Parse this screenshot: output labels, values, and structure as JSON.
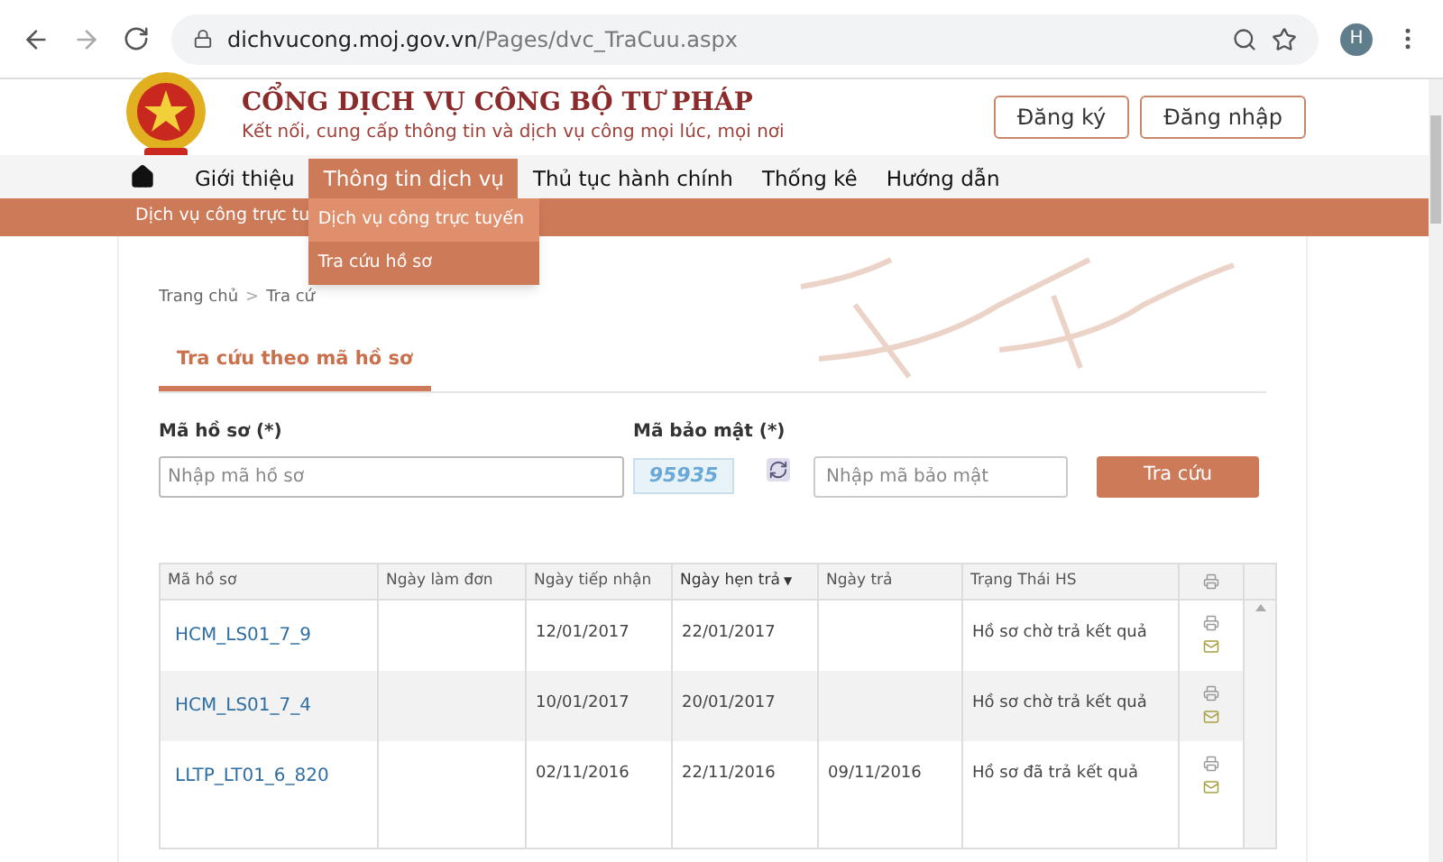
{
  "browser": {
    "url_host": "dichvucong.moj.gov.vn",
    "url_path": "/Pages/dvc_TraCuu.aspx",
    "profile": "H"
  },
  "header": {
    "title": "CỔNG DỊCH VỤ CÔNG BỘ TƯ PHÁP",
    "subtitle": "Kết nối, cung cấp thông tin và dịch vụ công mọi lúc, mọi nơi",
    "buttons": [
      "Đăng ký",
      "Đăng nhập"
    ]
  },
  "nav": {
    "items": [
      {
        "label": "Giới thiệu",
        "selected": false
      },
      {
        "label": "Thông tin dịch vụ",
        "selected": true
      },
      {
        "label": "Thủ tục hành chính",
        "selected": false
      },
      {
        "label": "Thống kê",
        "selected": false
      },
      {
        "label": "Hướng dẫn",
        "selected": false
      }
    ],
    "sub_bar": "Dịch vụ công trực tu",
    "dropdown": [
      {
        "label": "Dịch vụ công trực tuyến",
        "selected": true
      },
      {
        "label": "Tra cứu hồ sơ",
        "selected": false
      }
    ]
  },
  "breadcrumb": {
    "home": "Trang chủ",
    "separator": ">",
    "current": "Tra cứ"
  },
  "tabs": [
    {
      "label": "Tra cứu theo mã hồ sơ",
      "selected": true
    }
  ],
  "form": {
    "code_label": "Mã hồ sơ (*)",
    "code_placeholder": "Nhập mã hồ sơ",
    "captcha_label": "Mã bảo mật (*)",
    "captcha": "95935",
    "captcha_placeholder": "Nhập mã bảo mật",
    "submit": "Tra cứu"
  },
  "table": {
    "columns": [
      {
        "label": "Mã hồ sơ",
        "sorted": false
      },
      {
        "label": "Ngày làm đơn",
        "sorted": false
      },
      {
        "label": "Ngày tiếp nhận",
        "sorted": false
      },
      {
        "label": "Ngày hẹn trả",
        "sorted": true
      },
      {
        "label": "Ngày trả",
        "sorted": false
      },
      {
        "label": "Trạng Thái HS",
        "sorted": false
      }
    ],
    "sort_mark": "▼",
    "rows": [
      {
        "cells": [
          "HCM_LS01_7_9",
          "",
          "12/01/2017",
          "22/01/2017",
          "",
          "Hồ sơ chờ trả kết quả"
        ]
      },
      {
        "cells": [
          "HCM_LS01_7_4",
          "",
          "10/01/2017",
          "20/01/2017",
          "",
          "Hồ sơ chờ trả kết quả"
        ]
      },
      {
        "cells": [
          "LLTP_LT01_6_820",
          "",
          "02/11/2016",
          "22/11/2016",
          "09/11/2016",
          "Hồ sơ đã trả kết quả"
        ]
      }
    ]
  }
}
